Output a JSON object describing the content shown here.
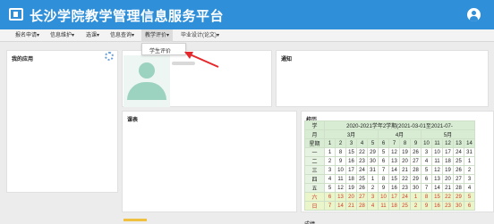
{
  "header": {
    "title": "长沙学院教学管理信息服务平台"
  },
  "nav": {
    "items": [
      {
        "label": "报名申请▾"
      },
      {
        "label": "信息维护▾"
      },
      {
        "label": "选课▾"
      },
      {
        "label": "信息查询▾"
      },
      {
        "label": "教学评价▾"
      },
      {
        "label": "毕业设计(论文)▾"
      }
    ],
    "dropdown_item": "学生评价"
  },
  "panels": {
    "my_apps": "我的应用",
    "notice": "通知",
    "schedule": "课表",
    "calendar": "校历",
    "bottom_right": "成绩"
  },
  "calendar": {
    "title": "2020-2021学年2学期(2021-03-01至2021-07-",
    "col_header_top": "学",
    "col_header_mid": "月",
    "col_header_bot": "周",
    "weekday_label": "星期",
    "months": [
      "3月",
      "4月",
      "5月"
    ],
    "weeks": [
      "1",
      "2",
      "3",
      "4",
      "5",
      "6",
      "7",
      "8",
      "9",
      "10",
      "11",
      "12",
      "13",
      "14"
    ],
    "rows": [
      {
        "day": "一",
        "cells": [
          "1",
          "8",
          "15",
          "22",
          "29",
          "5",
          "12",
          "19",
          "26",
          "3",
          "10",
          "17",
          "24",
          "31"
        ]
      },
      {
        "day": "二",
        "cells": [
          "2",
          "9",
          "16",
          "23",
          "30",
          "6",
          "13",
          "20",
          "27",
          "4",
          "11",
          "18",
          "25",
          "1"
        ]
      },
      {
        "day": "三",
        "cells": [
          "3",
          "10",
          "17",
          "24",
          "31",
          "7",
          "14",
          "21",
          "28",
          "5",
          "12",
          "19",
          "26",
          "2"
        ]
      },
      {
        "day": "四",
        "cells": [
          "4",
          "11",
          "18",
          "25",
          "1",
          "8",
          "15",
          "22",
          "29",
          "6",
          "13",
          "20",
          "27",
          "3"
        ]
      },
      {
        "day": "五",
        "cells": [
          "5",
          "12",
          "19",
          "26",
          "2",
          "9",
          "16",
          "23",
          "30",
          "7",
          "14",
          "21",
          "28",
          "4"
        ]
      },
      {
        "day": "六",
        "cells": [
          "6",
          "13",
          "20",
          "27",
          "3",
          "10",
          "17",
          "24",
          "1",
          "8",
          "15",
          "22",
          "29",
          "5"
        ]
      },
      {
        "day": "日",
        "cells": [
          "7",
          "14",
          "21",
          "28",
          "4",
          "11",
          "18",
          "25",
          "2",
          "9",
          "16",
          "23",
          "30",
          "6"
        ]
      }
    ]
  },
  "colors": {
    "header": "#2f8fd8",
    "weekend": "#d23b2b",
    "arrow": "#e5282b"
  }
}
